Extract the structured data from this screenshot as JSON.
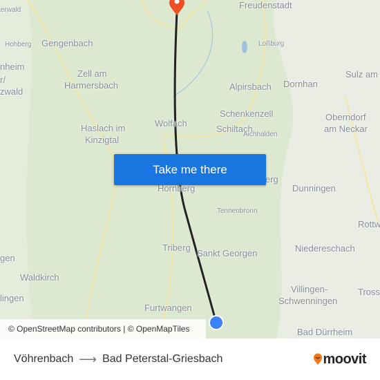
{
  "map": {
    "labels": [
      "Freudenstadt",
      "terwald",
      "Hohberg",
      "Gengenbach",
      "Loßburg",
      "nheim",
      "Zell am",
      "Harmersbach",
      "r/",
      "zwald",
      "Alpirsbach",
      "Dornhan",
      "Sulz am",
      "Schenkenzell",
      "Schiltach",
      "Oberndorf",
      "am Neckar",
      "Wolfach",
      "Haslach im",
      "Kinzigtal",
      "Aichhalden",
      "Hornberg",
      "erg",
      "Dunningen",
      "Tennenbronn",
      "Rottw",
      "Niedereschach",
      "gen",
      "Triberg",
      "Sankt Georgen",
      "Waldkirch",
      "Villingen-",
      "Schwenningen",
      "Tross",
      "lingen",
      "Furtwangen",
      "Bad Dürrheim"
    ],
    "origin_marker_color": "#3b82f6",
    "destination_marker_color": "#f04e23",
    "route_color": "#222222",
    "attribution": "© OpenStreetMap contributors | © OpenMapTiles"
  },
  "cta": {
    "label": "Take me there",
    "color": "#1976e0"
  },
  "footer": {
    "origin": "Vöhrenbach",
    "arrow_icon": "arrow-right-icon",
    "destination": "Bad Peterstal-Griesbach",
    "brand": "moovit"
  }
}
